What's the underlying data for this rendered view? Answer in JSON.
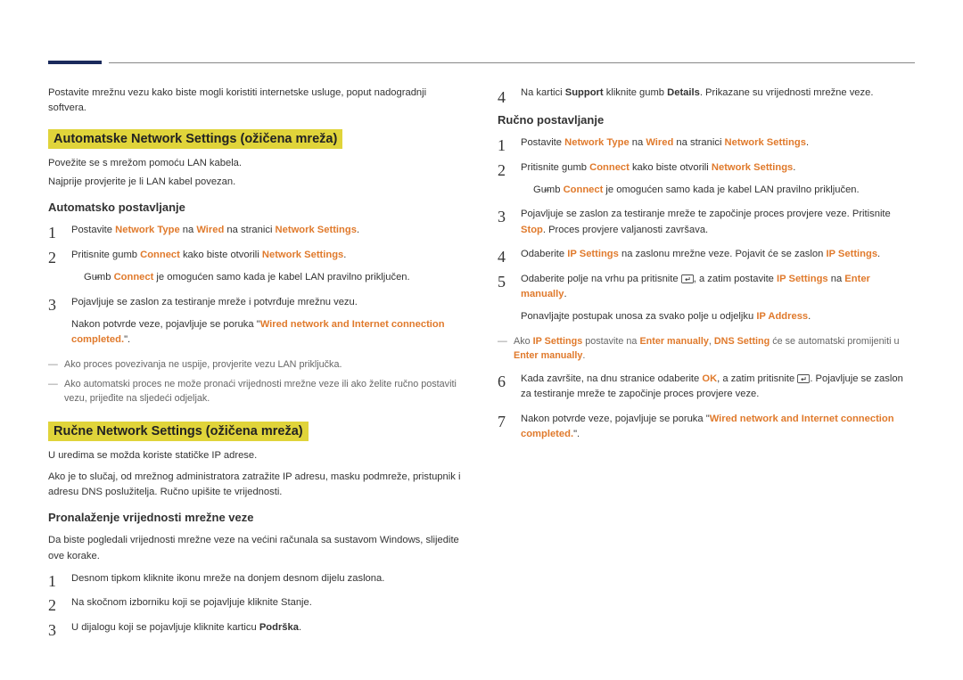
{
  "intro": "Postavite mrežnu vezu kako biste mogli koristiti internetske usluge, poput nadogradnji softvera.",
  "sec1": {
    "title": "Automatske Network Settings  (ožičena mreža)",
    "sub1": "Povežite se s mrežom pomoću LAN kabela.",
    "sub2": "Najprije provjerite je li LAN kabel povezan.",
    "h": "Automatsko postavljanje",
    "s1a": "Postavite ",
    "s1b": "Network Type",
    "s1c": " na ",
    "s1d": "Wired",
    "s1e": " na stranici ",
    "s1f": "Network Settings",
    "s1g": ".",
    "s2a": "Pritisnite gumb ",
    "s2b": "Connect",
    "s2c": " kako biste otvorili ",
    "s2d": "Network Settings",
    "s2e": ".",
    "s2sub_a": "Gumb ",
    "s2sub_b": "Connect",
    "s2sub_c": " je omogućen samo kada je kabel LAN pravilno priključen.",
    "s3": "Pojavljuje se zaslon za testiranje mreže i potvrđuje mrežnu vezu.",
    "s3post_a": "Nakon potvrde veze, pojavljuje se poruka \"",
    "s3post_b": "Wired network and Internet connection completed.",
    "s3post_c": "\".",
    "n1": "Ako proces povezivanja ne uspije, provjerite vezu LAN priključka.",
    "n2": "Ako automatski proces ne može pronaći vrijednosti mrežne veze ili ako želite ručno postaviti vezu, prijeđite na sljedeći odjeljak."
  },
  "sec2": {
    "title": "Ručne Network Settings  (ožičena mreža)",
    "p1": "U uredima se možda koriste statičke IP adrese.",
    "p2": "Ako je to slučaj, od mrežnog administratora zatražite IP adresu, masku podmreže, pristupnik i adresu DNS poslužitelja. Ručno upišite te vrijednosti.",
    "h1": "Pronalaženje vrijednosti mrežne veze",
    "p3": "Da biste pogledali vrijednosti mrežne veze na većini računala sa sustavom Windows, slijedite ove korake.",
    "s1": "Desnom tipkom kliknite ikonu mreže na donjem desnom dijelu zaslona.",
    "s2": "Na skočnom izborniku koji se pojavljuje kliknite Stanje.",
    "s3a": "U dijalogu koji se pojavljuje kliknite karticu ",
    "s3b": "Podrška",
    "s3c": ".",
    "s4a": "Na kartici ",
    "s4b": "Support",
    "s4c": " kliknite gumb ",
    "s4d": "Details",
    "s4e": ". Prikazane su vrijednosti mrežne veze."
  },
  "sec3": {
    "h": "Ručno postavljanje",
    "s1a": "Postavite ",
    "s1b": "Network Type",
    "s1c": " na ",
    "s1d": "Wired",
    "s1e": " na stranici ",
    "s1f": "Network Settings",
    "s1g": ".",
    "s2a": "Pritisnite gumb ",
    "s2b": "Connect",
    "s2c": " kako biste otvorili ",
    "s2d": "Network Settings",
    "s2e": ".",
    "s2sub_a": "Gumb ",
    "s2sub_b": "Connect",
    "s2sub_c": " je omogućen samo kada je kabel LAN pravilno priključen.",
    "s3a": "Pojavljuje se zaslon za testiranje mreže te započinje proces provjere veze. Pritisnite ",
    "s3b": "Stop",
    "s3c": ". Proces provjere valjanosti završava.",
    "s4a": "Odaberite ",
    "s4b": "IP Settings",
    "s4c": " na zaslonu mrežne veze. Pojavit će se zaslon ",
    "s4d": "IP Settings",
    "s4e": ".",
    "s5a": "Odaberite polje na vrhu pa pritisnite ",
    "s5b": ", a zatim postavite ",
    "s5c": "IP Settings",
    "s5d": " na ",
    "s5e": "Enter manually",
    "s5f": ".",
    "s5post": "Ponavljajte postupak unosa za svako polje u odjeljku ",
    "s5post_b": "IP Address",
    "s5post_c": ".",
    "n1a": "Ako ",
    "n1b": "IP Settings",
    "n1c": " postavite na ",
    "n1d": "Enter manually",
    "n1e": ", ",
    "n1f": "DNS Setting",
    "n1g": " će se automatski promijeniti u ",
    "n1h": "Enter manually",
    "n1i": ".",
    "s6a": "Kada završite, na dnu stranice odaberite ",
    "s6b": "OK",
    "s6c": ", a zatim pritisnite ",
    "s6d": ". Pojavljuje se zaslon za testiranje mreže te započinje proces provjere veze.",
    "s7a": "Nakon potvrde veze, pojavljuje se poruka \"",
    "s7b": "Wired network and Internet connection completed.",
    "s7c": "\"."
  }
}
